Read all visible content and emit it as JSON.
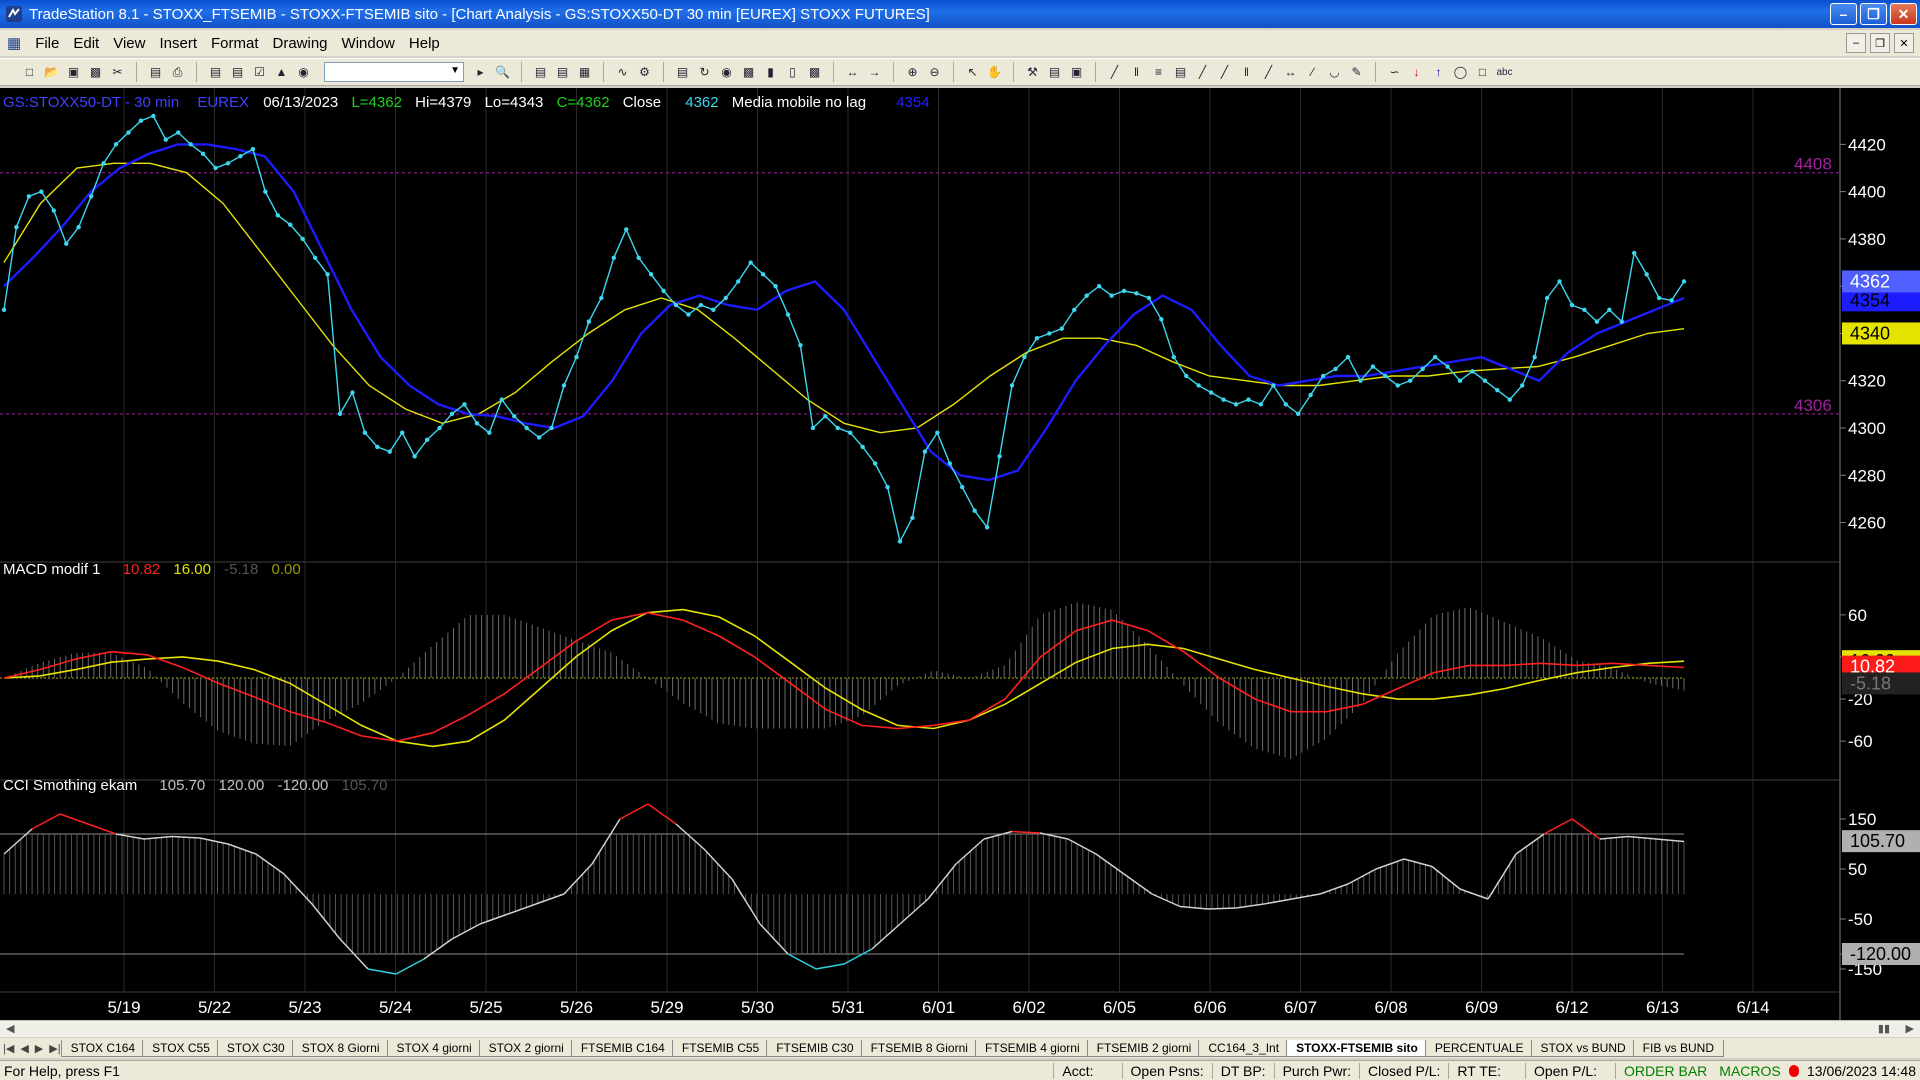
{
  "window": {
    "title": "TradeStation 8.1 - STOXX_FTSEMIB - STOXX-FTSEMIB sito - [Chart Analysis - GS:STOXX50-DT  30 min  [EUREX] STOXX FUTURES]"
  },
  "menu": [
    "File",
    "Edit",
    "View",
    "Insert",
    "Format",
    "Drawing",
    "Window",
    "Help"
  ],
  "price_header": {
    "symbol": "GS:STOXX50-DT - 30 min",
    "exchange": "EUREX",
    "date": "06/13/2023",
    "last": "L=4362",
    "high": "Hi=4379",
    "low": "Lo=4343",
    "close": "C=4362",
    "close_label": "Close",
    "close_value": "4362",
    "ma_label": "Media mobile no lag",
    "ma_value": "4354"
  },
  "macd_header": {
    "name": "MACD modif 1",
    "v1": "10.82",
    "v2": "16.00",
    "v3": "-5.18",
    "v4": "0.00"
  },
  "cci_header": {
    "name": "CCI Smothing ekam",
    "v1": "105.70",
    "v2": "120.00",
    "v3": "-120.00",
    "v4": "105.70"
  },
  "colors": {
    "price": "#3cd8f0",
    "ma_blue": "#1c1cff",
    "ma_yellow": "#e4e400",
    "macd": "#ff2020",
    "signal": "#e4e400",
    "cci": "#d0d0d0",
    "cci_hi": "#ff2020",
    "cci_lo": "#30d0e0",
    "level": "#a020a0"
  },
  "chart_data": [
    {
      "type": "line",
      "title": "GS:STOXX50-DT - 30 min",
      "x_dates": [
        "5/19",
        "5/22",
        "5/23",
        "5/24",
        "5/25",
        "5/26",
        "5/29",
        "5/30",
        "5/31",
        "6/01",
        "6/02",
        "6/05",
        "6/06",
        "6/07",
        "6/08",
        "6/09",
        "6/12",
        "6/13",
        "6/14"
      ],
      "ylim": [
        4245,
        4432
      ],
      "y_ticks": [
        4420,
        4400,
        4380,
        4360,
        4340,
        4320,
        4300,
        4280,
        4260
      ],
      "levels": [
        4408,
        4306
      ],
      "last_labels": {
        "close": "4362",
        "ma": "4354",
        "ma2": "4340"
      },
      "series": [
        {
          "name": "Close",
          "values": [
            4350,
            4385,
            4398,
            4400,
            4392,
            4378,
            4385,
            4398,
            4412,
            4420,
            4425,
            4430,
            4432,
            4422,
            4425,
            4420,
            4416,
            4410,
            4412,
            4415,
            4418,
            4400,
            4390,
            4386,
            4380,
            4372,
            4365,
            4306,
            4315,
            4298,
            4292,
            4290,
            4298,
            4288,
            4295,
            4300,
            4306,
            4310,
            4302,
            4298,
            4312,
            4305,
            4300,
            4296,
            4300,
            4318,
            4330,
            4345,
            4355,
            4372,
            4384,
            4372,
            4365,
            4358,
            4352,
            4348,
            4352,
            4350,
            4355,
            4362,
            4370,
            4365,
            4360,
            4348,
            4335,
            4300,
            4305,
            4300,
            4298,
            4292,
            4285,
            4275,
            4252,
            4262,
            4290,
            4298,
            4285,
            4275,
            4265,
            4258,
            4288,
            4318,
            4330,
            4338,
            4340,
            4342,
            4350,
            4356,
            4360,
            4356,
            4358,
            4357,
            4355,
            4346,
            4330,
            4322,
            4318,
            4315,
            4312,
            4310,
            4312,
            4310,
            4318,
            4310,
            4306,
            4314,
            4322,
            4325,
            4330,
            4320,
            4326,
            4322,
            4318,
            4320,
            4325,
            4330,
            4326,
            4320,
            4324,
            4320,
            4316,
            4312,
            4318,
            4330,
            4355,
            4362,
            4352,
            4350,
            4345,
            4350,
            4345,
            4374,
            4365,
            4355,
            4354,
            4362
          ]
        },
        {
          "name": "Media mobile no lag",
          "values": [
            4360,
            4372,
            4385,
            4400,
            4410,
            4416,
            4420,
            4420,
            4418,
            4415,
            4400,
            4375,
            4350,
            4330,
            4318,
            4310,
            4306,
            4305,
            4302,
            4300,
            4305,
            4320,
            4340,
            4352,
            4356,
            4352,
            4350,
            4358,
            4362,
            4350,
            4330,
            4310,
            4290,
            4280,
            4278,
            4282,
            4300,
            4320,
            4335,
            4348,
            4356,
            4350,
            4335,
            4322,
            4318,
            4320,
            4322,
            4322,
            4324,
            4326,
            4328,
            4330,
            4325,
            4320,
            4332,
            4340,
            4345,
            4350,
            4355
          ]
        },
        {
          "name": "MA2",
          "values": [
            4370,
            4395,
            4410,
            4412,
            4412,
            4408,
            4395,
            4375,
            4355,
            4335,
            4318,
            4308,
            4302,
            4306,
            4315,
            4328,
            4340,
            4350,
            4355,
            4350,
            4338,
            4325,
            4312,
            4302,
            4298,
            4300,
            4310,
            4322,
            4332,
            4338,
            4338,
            4335,
            4328,
            4322,
            4320,
            4318,
            4318,
            4320,
            4322,
            4322,
            4324,
            4325,
            4326,
            4330,
            4335,
            4340,
            4342
          ]
        }
      ]
    },
    {
      "type": "line",
      "title": "MACD modif 1",
      "ylim": [
        -95,
        95
      ],
      "y_ticks": [
        60,
        20,
        -20,
        -60
      ],
      "last_labels": {
        "macd": "10.82",
        "signal": "16.00",
        "hist": "-5.18"
      },
      "series": [
        {
          "name": "MACD",
          "values": [
            0,
            8,
            18,
            25,
            22,
            10,
            -5,
            -18,
            -32,
            -42,
            -55,
            -60,
            -52,
            -35,
            -15,
            10,
            35,
            55,
            62,
            55,
            40,
            20,
            -5,
            -30,
            -45,
            -48,
            -45,
            -40,
            -20,
            20,
            45,
            55,
            45,
            25,
            0,
            -20,
            -32,
            -32,
            -25,
            -10,
            5,
            12,
            12,
            14,
            12,
            14,
            12,
            10
          ]
        },
        {
          "name": "Signal",
          "values": [
            0,
            2,
            8,
            15,
            18,
            20,
            16,
            8,
            -5,
            -25,
            -45,
            -60,
            -65,
            -60,
            -40,
            -10,
            20,
            45,
            62,
            65,
            58,
            40,
            15,
            -10,
            -30,
            -45,
            -48,
            -40,
            -25,
            -5,
            15,
            28,
            32,
            28,
            18,
            8,
            0,
            -8,
            -15,
            -20,
            -20,
            -16,
            -10,
            -2,
            5,
            10,
            14,
            16
          ]
        },
        {
          "name": "Histogram",
          "values": [
            0,
            6,
            10,
            10,
            4,
            -10,
            -21,
            -26,
            -27,
            -17,
            -10,
            0,
            13,
            25,
            25,
            20,
            15,
            10,
            0,
            -10,
            -18,
            -20,
            -20,
            -20,
            -15,
            -3,
            3,
            0,
            5,
            25,
            30,
            27,
            13,
            -3,
            -18,
            -28,
            -32,
            -24,
            -10,
            10,
            25,
            28,
            22,
            16,
            7,
            4,
            -2,
            -5
          ]
        }
      ]
    },
    {
      "type": "line",
      "title": "CCI Smothing ekam",
      "ylim": [
        -200,
        200
      ],
      "y_ticks": [
        150,
        50,
        -50,
        -120,
        -150
      ],
      "levels": [
        120,
        -120
      ],
      "last_labels": {
        "cci": "105.70",
        "level_low": "-120.00"
      },
      "series": [
        {
          "name": "CCI",
          "values": [
            80,
            130,
            160,
            140,
            120,
            110,
            115,
            112,
            100,
            80,
            40,
            -20,
            -90,
            -150,
            -160,
            -130,
            -90,
            -60,
            -40,
            -20,
            0,
            60,
            150,
            180,
            140,
            90,
            30,
            -60,
            -120,
            -150,
            -140,
            -110,
            -60,
            -10,
            60,
            110,
            125,
            122,
            110,
            80,
            40,
            0,
            -25,
            -30,
            -28,
            -20,
            -10,
            0,
            20,
            50,
            70,
            55,
            10,
            -10,
            80,
            120,
            150,
            110,
            115,
            110,
            105
          ]
        }
      ]
    }
  ],
  "tabs": [
    "STOX C164",
    "STOX C55",
    "STOX  C30",
    "STOX  8 Giorni",
    "STOX 4 giorni",
    "STOX  2 giorni",
    "FTSEMIB C164",
    "FTSEMIB C55",
    "FTSEMIB C30",
    "FTSEMIB  8 Giorni",
    "FTSEMIB  4 giorni",
    "FTSEMIB  2 giorni",
    "CC164_3_Int",
    "STOXX-FTSEMIB sito",
    "PERCENTUALE",
    "STOX vs BUND",
    "FIB vs BUND"
  ],
  "active_tab": "STOXX-FTSEMIB sito",
  "status": {
    "help": "For Help, press F1",
    "acct": "Acct:",
    "open_psns": "Open Psns:",
    "dt_bp": "DT BP:",
    "purch_pwr": "Purch Pwr:",
    "closed_pl": "Closed P/L:",
    "rt_te": "RT TE:",
    "open_pl": "Open P/L:",
    "order_bar": "ORDER BAR",
    "macros": "MACROS",
    "datetime": "13/06/2023 14:48"
  }
}
